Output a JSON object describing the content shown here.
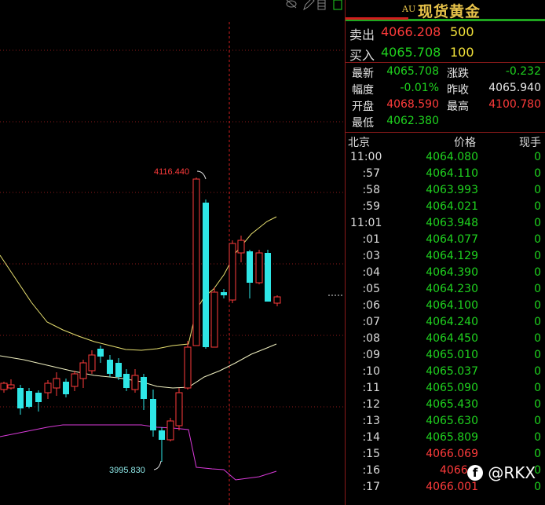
{
  "colors": {
    "up": "#ff3b3b",
    "down": "#2ee6e6",
    "ma_yellow": "#e8e070",
    "ma_white": "#f0f0c0",
    "ma_magenta": "#d83ad8",
    "bg": "#000000"
  },
  "chart": {
    "high_label": "4116.440",
    "low_label": "3995.830"
  },
  "toolbar_icons": [
    "eye-off-icon",
    "pencil-icon",
    "layers-icon"
  ],
  "panel": {
    "symbol_tag": "AU",
    "title": "现货黄金",
    "ask": {
      "label": "卖出",
      "price": "4066.208",
      "volume": "500"
    },
    "bid": {
      "label": "买入",
      "price": "4065.708",
      "volume": "100"
    },
    "stats": {
      "last_label": "最新",
      "last": "4065.708",
      "change_label": "涨跌",
      "change": "-0.232",
      "pct_label": "幅度",
      "pct": "-0.01%",
      "prev_label": "昨收",
      "prev": "4065.940",
      "open_label": "开盘",
      "open": "4068.590",
      "high_label": "最高",
      "high": "4100.780",
      "low_label": "最低",
      "low": "4062.380"
    },
    "ticks_header": {
      "region": "北京",
      "price": "价格",
      "volume": "现手"
    },
    "ticks": [
      {
        "time": "11:00",
        "price": "4064.080",
        "vol": "0",
        "dir": "green"
      },
      {
        "time": ":57",
        "price": "4064.110",
        "vol": "0",
        "dir": "green"
      },
      {
        "time": ":58",
        "price": "4063.993",
        "vol": "0",
        "dir": "green"
      },
      {
        "time": ":59",
        "price": "4064.021",
        "vol": "0",
        "dir": "green"
      },
      {
        "time": "11:01",
        "price": "4063.948",
        "vol": "0",
        "dir": "green"
      },
      {
        "time": ":01",
        "price": "4064.077",
        "vol": "0",
        "dir": "green"
      },
      {
        "time": ":03",
        "price": "4064.129",
        "vol": "0",
        "dir": "green"
      },
      {
        "time": ":04",
        "price": "4064.390",
        "vol": "0",
        "dir": "green"
      },
      {
        "time": ":05",
        "price": "4064.230",
        "vol": "0",
        "dir": "green"
      },
      {
        "time": ":06",
        "price": "4064.100",
        "vol": "0",
        "dir": "green"
      },
      {
        "time": ":07",
        "price": "4064.240",
        "vol": "0",
        "dir": "green"
      },
      {
        "time": ":08",
        "price": "4064.450",
        "vol": "0",
        "dir": "green"
      },
      {
        "time": ":09",
        "price": "4065.010",
        "vol": "0",
        "dir": "green"
      },
      {
        "time": ":10",
        "price": "4065.037",
        "vol": "0",
        "dir": "green"
      },
      {
        "time": ":11",
        "price": "4065.090",
        "vol": "0",
        "dir": "green"
      },
      {
        "time": ":12",
        "price": "4065.430",
        "vol": "0",
        "dir": "green"
      },
      {
        "time": ":13",
        "price": "4065.630",
        "vol": "0",
        "dir": "green"
      },
      {
        "time": ":14",
        "price": "4065.809",
        "vol": "0",
        "dir": "green"
      },
      {
        "time": ":15",
        "price": "4066.069",
        "vol": "0",
        "dir": "red"
      },
      {
        "time": ":16",
        "price": "4066.0",
        "vol": "0",
        "dir": "red"
      },
      {
        "time": ":17",
        "price": "4066.001",
        "vol": "0",
        "dir": "red"
      }
    ]
  },
  "watermark": {
    "icon": "facebook-icon",
    "text": "@RKX"
  }
}
